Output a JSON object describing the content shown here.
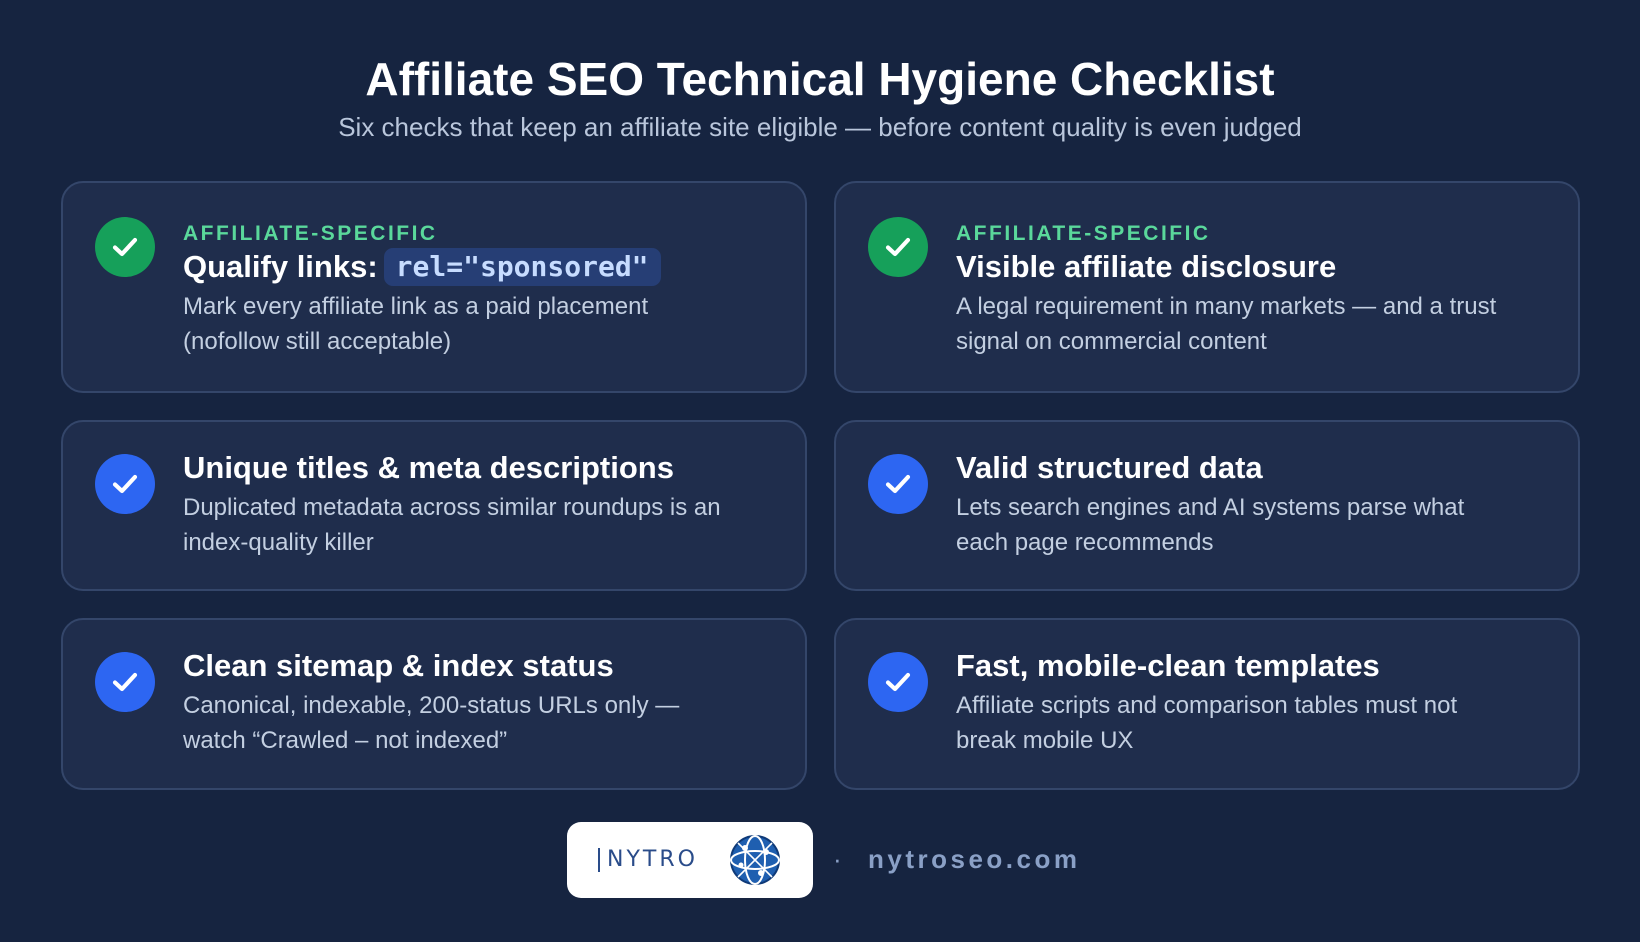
{
  "header": {
    "title": "Affiliate SEO Technical Hygiene Checklist",
    "subtitle": "Six checks that keep an affiliate site eligible — before content quality is even judged"
  },
  "colors": {
    "background": "#162440",
    "card": "#1f2d4c",
    "card_border": "#34466a",
    "check_green": "#16a05a",
    "check_blue": "#2d66f2",
    "eyebrow_green": "#5ad89b"
  },
  "cards": [
    {
      "eyebrow": "AFFILIATE-SPECIFIC",
      "title": "Qualify links:",
      "code": "rel=\"sponsored\"",
      "desc_line1": "Mark every affiliate link as a paid placement",
      "desc_line2": "(nofollow still acceptable)",
      "icon": "check-icon",
      "badge_color": "green"
    },
    {
      "eyebrow": "AFFILIATE-SPECIFIC",
      "title": "Visible affiliate disclosure",
      "desc_line1": "A legal requirement in many markets — and a trust",
      "desc_line2": "signal on commercial content",
      "icon": "check-icon",
      "badge_color": "green"
    },
    {
      "title": "Unique titles & meta descriptions",
      "desc_line1": "Duplicated metadata across similar roundups is an",
      "desc_line2": "index-quality killer",
      "icon": "check-icon",
      "badge_color": "blue"
    },
    {
      "title": "Valid structured data",
      "desc_line1": "Lets search engines and AI systems parse what",
      "desc_line2": "each page recommends",
      "icon": "check-icon",
      "badge_color": "blue"
    },
    {
      "title": "Clean sitemap & index status",
      "desc_line1": "Canonical, indexable, 200-status URLs only —",
      "desc_line2": "watch “Crawled – not indexed”",
      "icon": "check-icon",
      "badge_color": "blue"
    },
    {
      "title": "Fast, mobile-clean templates",
      "desc_line1": "Affiliate scripts and comparison tables must not",
      "desc_line2": "break mobile UX",
      "icon": "check-icon",
      "badge_color": "blue"
    }
  ],
  "footer": {
    "logo_text": "NYTRO",
    "logo_icon": "globe-icon",
    "separator": "·",
    "domain": "nytroseo.com"
  }
}
